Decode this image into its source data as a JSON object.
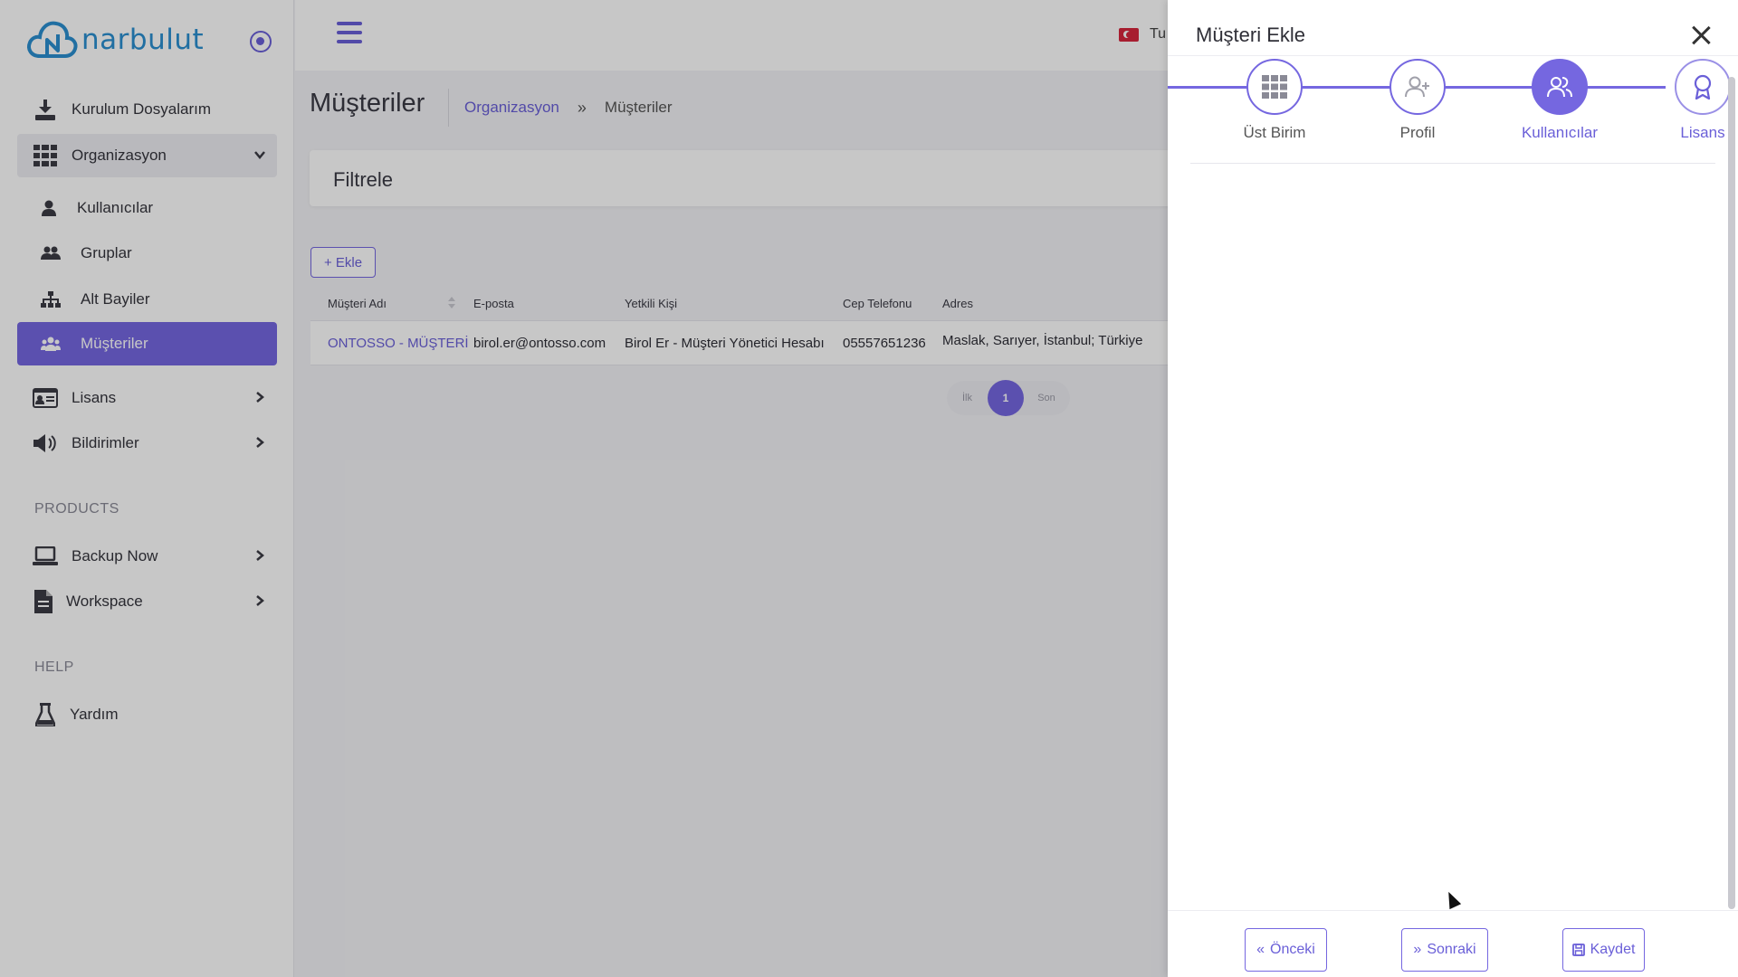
{
  "app": {
    "logo_text": "narbulut",
    "brand_color": "#2b8fd0",
    "accent_color": "#7567e0"
  },
  "sidebar": {
    "items": [
      {
        "label": "Kurulum Dosyalarım",
        "icon": "download-icon"
      },
      {
        "label": "Organizasyon",
        "icon": "grid-icon",
        "expanded": true
      },
      {
        "label": "Kullanıcılar",
        "icon": "user-icon"
      },
      {
        "label": "Gruplar",
        "icon": "users-icon"
      },
      {
        "label": "Alt Bayiler",
        "icon": "sitemap-icon"
      },
      {
        "label": "Müşteriler",
        "icon": "users-group-icon",
        "active": true
      },
      {
        "label": "Lisans",
        "icon": "id-card-icon"
      },
      {
        "label": "Bildirimler",
        "icon": "megaphone-icon"
      },
      {
        "label": "Backup Now",
        "icon": "laptop-icon"
      },
      {
        "label": "Workspace",
        "icon": "file-icon"
      },
      {
        "label": "Yardım",
        "icon": "flask-icon"
      }
    ],
    "sections": {
      "products": "PRODUCTS",
      "help": "HELP"
    }
  },
  "topbar": {
    "language_label": "Tu"
  },
  "main": {
    "title": "Müşteriler",
    "breadcrumb": {
      "parent": "Organizasyon",
      "separator": "»",
      "current": "Müşteriler"
    },
    "filter_title": "Filtrele",
    "add_button": "+ Ekle",
    "table": {
      "columns": [
        "Müşteri Adı",
        "E-posta",
        "Yetkili Kişi",
        "Cep Telefonu",
        "Adres"
      ],
      "rows": [
        [
          "ONTOSSO - MÜŞTERİ",
          "birol.er@ontosso.com",
          "Birol Er - Müşteri Yönetici Hesabı",
          "05557651236",
          "Maslak, Sarıyer, İstanbul; Türkiye"
        ]
      ]
    },
    "pagination": {
      "first": "İlk",
      "current": "1",
      "last": "Son"
    }
  },
  "drawer": {
    "title": "Müşteri Ekle",
    "steps": [
      {
        "label": "Üst Birim",
        "icon": "grid-icon",
        "state": "done"
      },
      {
        "label": "Profil",
        "icon": "user-plus-icon",
        "state": "done"
      },
      {
        "label": "Kullanıcılar",
        "icon": "users-icon",
        "state": "active"
      },
      {
        "label": "Lisans",
        "icon": "award-icon",
        "state": "next"
      }
    ],
    "footer": {
      "prev": "Önceki",
      "next": "Sonraki",
      "save": "Kaydet"
    }
  }
}
